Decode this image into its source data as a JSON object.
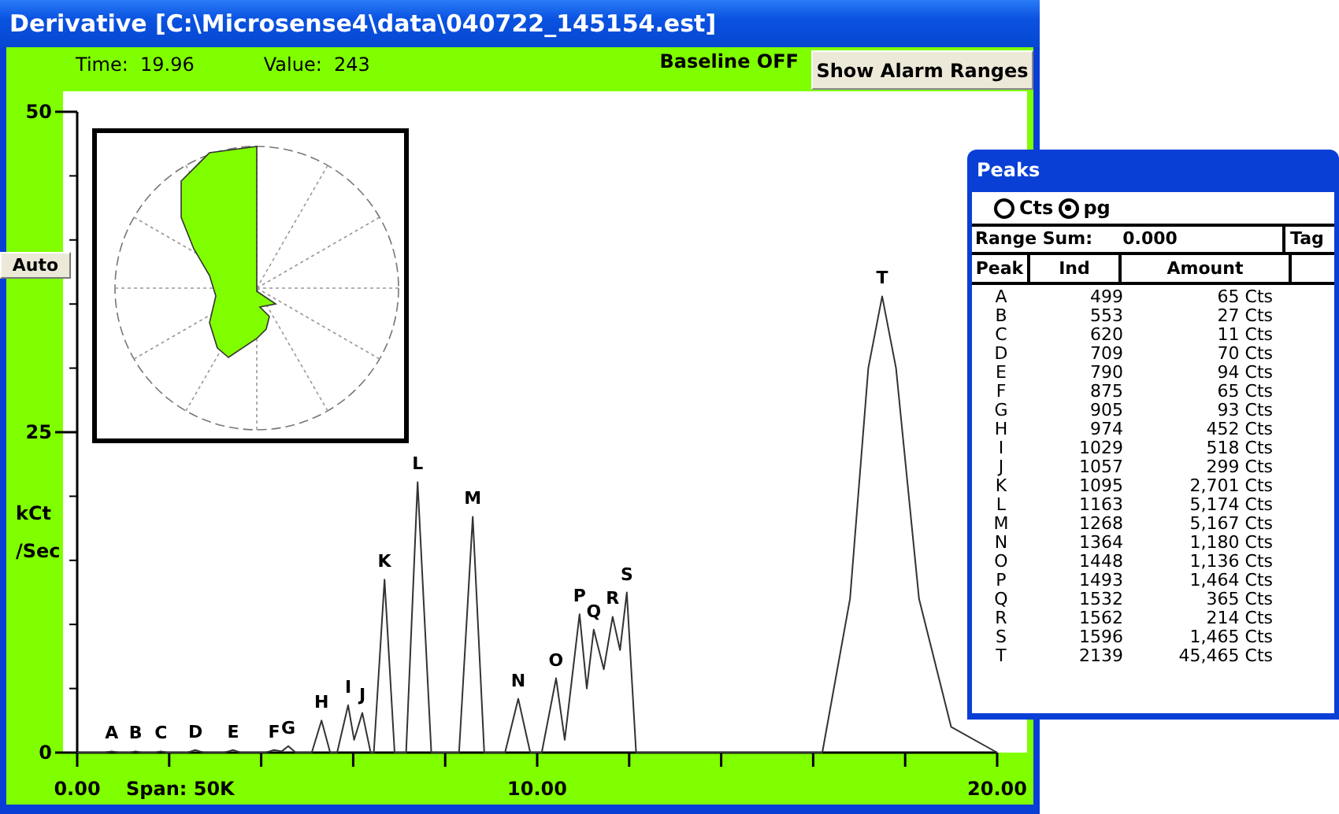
{
  "main_window": {
    "title": "Derivative [C:\\Microsense4\\data\\040722_145154.est]",
    "time_label": "Time:",
    "time": "19.96",
    "value_label": "Value:",
    "value": "243",
    "baseline": "Baseline OFF",
    "alarm_button": "Show Alarm Ranges",
    "auto_button": "Auto",
    "span": "Span: 50K",
    "chart_data": {
      "type": "line",
      "ylabel": "kCt /Sec",
      "xlim": [
        0,
        20
      ],
      "ylim": [
        0,
        50
      ],
      "xticks": [
        {
          "value": 0,
          "label": "0.00"
        },
        {
          "value": 10,
          "label": "10.00"
        },
        {
          "value": 20,
          "label": "20.00"
        }
      ],
      "yticks": [
        0,
        25,
        50
      ],
      "x": [
        0,
        0.6,
        0.75,
        0.9,
        1.15,
        1.27,
        1.4,
        1.7,
        1.82,
        1.95,
        2.4,
        2.57,
        2.75,
        3.2,
        3.39,
        3.55,
        4.1,
        4.28,
        4.45,
        4.59,
        4.75,
        5.1,
        5.31,
        5.5,
        5.65,
        5.89,
        6.02,
        6.2,
        6.38,
        6.45,
        6.68,
        6.9,
        7.15,
        7.4,
        7.7,
        8.3,
        8.6,
        8.85,
        9.3,
        9.59,
        9.85,
        10.1,
        10.41,
        10.6,
        10.92,
        11.08,
        11.23,
        11.45,
        11.64,
        11.8,
        11.95,
        12.15,
        16.2,
        16.8,
        17.2,
        17.5,
        17.8,
        18.3,
        19,
        20
      ],
      "series": [
        {
          "color": "#333333",
          "values": [
            0,
            0,
            0.1,
            0,
            0,
            0.1,
            0,
            0,
            0.1,
            0,
            0,
            0.2,
            0,
            0,
            0.2,
            0,
            0,
            0.2,
            0.1,
            0.5,
            0,
            0,
            2.5,
            0,
            0,
            3.7,
            1,
            3.1,
            0,
            0,
            13.5,
            0,
            0,
            21.1,
            0,
            0,
            18.4,
            0,
            0,
            4.2,
            0,
            0,
            5.8,
            1,
            10.8,
            5,
            9.6,
            6.5,
            10.6,
            8,
            12.5,
            0,
            0,
            12,
            30,
            35.6,
            30,
            12,
            2,
            0
          ]
        }
      ],
      "annotations": [
        {
          "x": 0.75,
          "y": 0.1,
          "text": "A"
        },
        {
          "x": 1.27,
          "y": 0.1,
          "text": "B"
        },
        {
          "x": 1.82,
          "y": 0.1,
          "text": "C"
        },
        {
          "x": 2.57,
          "y": 0.2,
          "text": "D"
        },
        {
          "x": 3.39,
          "y": 0.2,
          "text": "E"
        },
        {
          "x": 4.28,
          "y": 0.2,
          "text": "F"
        },
        {
          "x": 4.59,
          "y": 0.5,
          "text": "G"
        },
        {
          "x": 5.31,
          "y": 2.5,
          "text": "H"
        },
        {
          "x": 5.89,
          "y": 3.7,
          "text": "I"
        },
        {
          "x": 6.2,
          "y": 3.1,
          "text": "J"
        },
        {
          "x": 6.68,
          "y": 13.5,
          "text": "K"
        },
        {
          "x": 7.4,
          "y": 21.1,
          "text": "L"
        },
        {
          "x": 8.6,
          "y": 18.4,
          "text": "M"
        },
        {
          "x": 9.59,
          "y": 4.2,
          "text": "N"
        },
        {
          "x": 10.41,
          "y": 5.8,
          "text": "O"
        },
        {
          "x": 10.92,
          "y": 10.8,
          "text": "P"
        },
        {
          "x": 11.23,
          "y": 9.6,
          "text": "Q"
        },
        {
          "x": 11.64,
          "y": 10.6,
          "text": "R"
        },
        {
          "x": 11.95,
          "y": 12.5,
          "text": "S"
        },
        {
          "x": 17.5,
          "y": 35.6,
          "text": "T"
        }
      ]
    }
  },
  "peaks_window": {
    "title": "Peaks",
    "units": [
      {
        "label": "Cts",
        "selected": false
      },
      {
        "label": "pg",
        "selected": true
      }
    ],
    "range_sum_label": "Range Sum:",
    "range_sum": "0.000",
    "tag_header": "Tag",
    "columns": [
      "Peak",
      "Ind",
      "Amount"
    ],
    "rows": [
      [
        "A",
        "499",
        "65 Cts"
      ],
      [
        "B",
        "553",
        "27 Cts"
      ],
      [
        "C",
        "620",
        "11 Cts"
      ],
      [
        "D",
        "709",
        "70 Cts"
      ],
      [
        "E",
        "790",
        "94 Cts"
      ],
      [
        "F",
        "875",
        "65 Cts"
      ],
      [
        "G",
        "905",
        "93 Cts"
      ],
      [
        "H",
        "974",
        "452 Cts"
      ],
      [
        "I",
        "1029",
        "518 Cts"
      ],
      [
        "J",
        "1057",
        "299 Cts"
      ],
      [
        "K",
        "1095",
        "2,701 Cts"
      ],
      [
        "L",
        "1163",
        "5,174 Cts"
      ],
      [
        "M",
        "1268",
        "5,167 Cts"
      ],
      [
        "N",
        "1364",
        "1,180 Cts"
      ],
      [
        "O",
        "1448",
        "1,136 Cts"
      ],
      [
        "P",
        "1493",
        "1,464 Cts"
      ],
      [
        "Q",
        "1532",
        "365 Cts"
      ],
      [
        "R",
        "1562",
        "214 Cts"
      ],
      [
        "S",
        "1596",
        "1,465 Cts"
      ],
      [
        "T",
        "2139",
        "45,465 Cts"
      ]
    ]
  }
}
